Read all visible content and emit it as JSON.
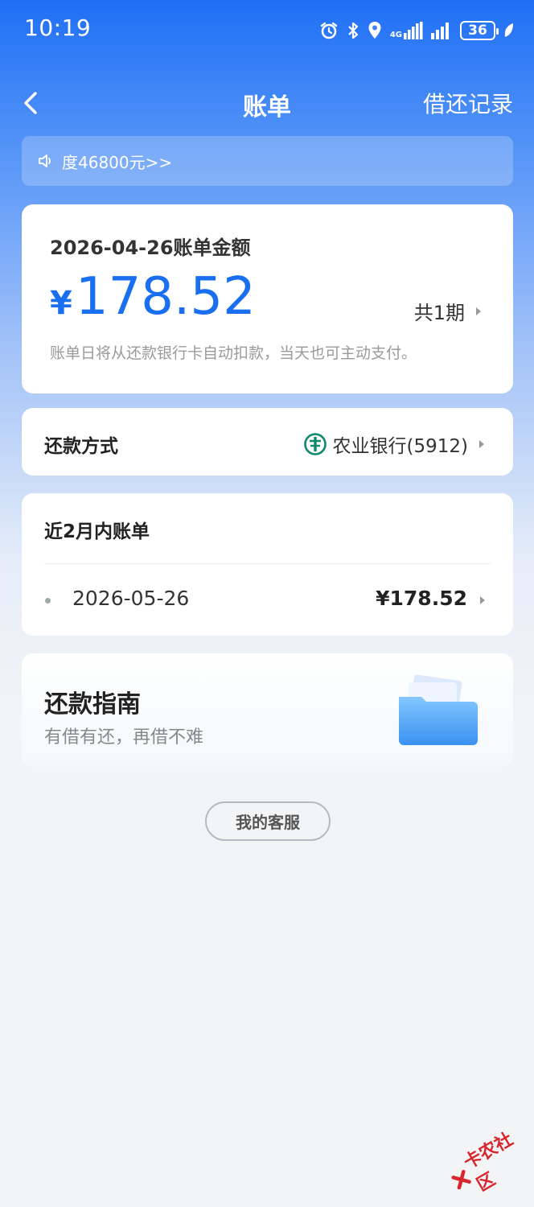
{
  "status_bar": {
    "time": "10:19",
    "network_label": "4G",
    "battery": "36"
  },
  "nav": {
    "title": "账单",
    "right_link": "借还记录"
  },
  "notice": {
    "text": "​度46800元>>"
  },
  "bill": {
    "date_label": "2026-04-26账单金额",
    "currency": "¥",
    "amount": "178.52",
    "periods": "共1期",
    "note": "账单日将从还款银行卡自动扣款，当天也可主动支付。"
  },
  "payment": {
    "label": "还款方式",
    "bank": "农业银行(5912)"
  },
  "recent": {
    "title": "近2月内账单",
    "rows": [
      {
        "date": "2026-05-26",
        "amount": "¥178.52"
      }
    ]
  },
  "guide": {
    "title": "还款指南",
    "subtitle": "有借有还，再借不难"
  },
  "service_button": "我的客服",
  "watermark": "卡农社区",
  "colors": {
    "brand_blue": "#1a6ff1",
    "bank_green": "#0e8a6b",
    "watermark_red": "#d8262c"
  }
}
